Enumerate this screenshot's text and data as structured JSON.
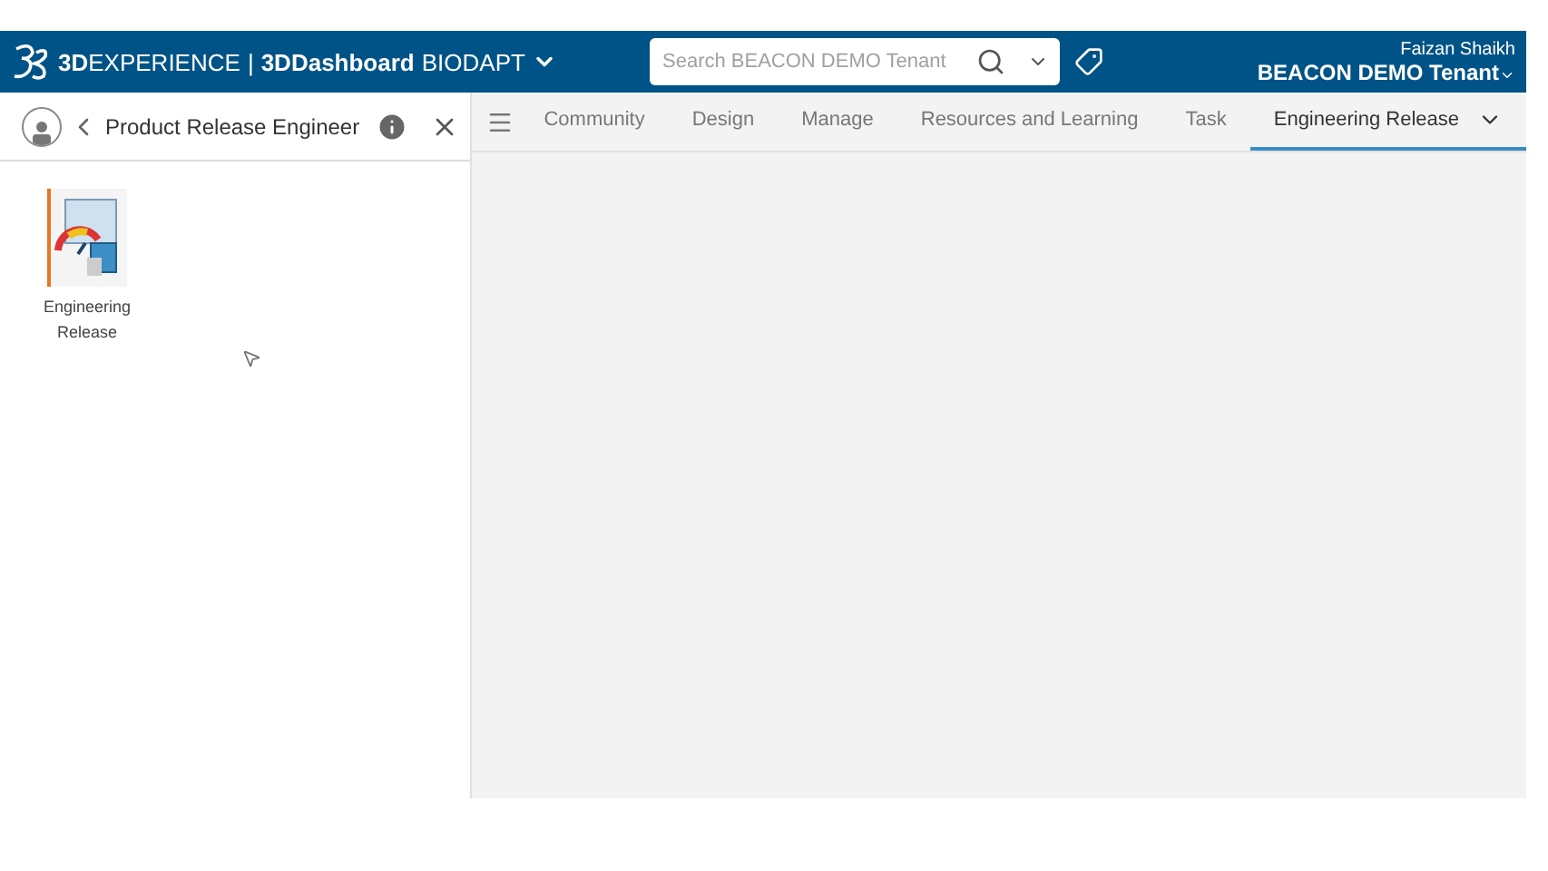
{
  "top_bar": {
    "brand": "**3D**EXPERIENCE",
    "separator": "|",
    "app": "3DDashboard",
    "dashboard": "BIODAPT",
    "search": {
      "placeholder": "Search BEACON DEMO Tenant"
    },
    "user": "Faizan Shaikh",
    "tenant": "BEACON DEMO Tenant"
  },
  "side_panel": {
    "title": "Product Release Engineer",
    "apps": [
      {
        "label": "Engineering Release"
      }
    ]
  },
  "tabs": [
    {
      "label": "Community",
      "selected": false
    },
    {
      "label": "Design",
      "selected": false
    },
    {
      "label": "Manage",
      "selected": false
    },
    {
      "label": "Resources and Learning",
      "selected": false
    },
    {
      "label": "Task",
      "selected": false
    },
    {
      "label": "Engineering Release",
      "selected": true
    }
  ]
}
